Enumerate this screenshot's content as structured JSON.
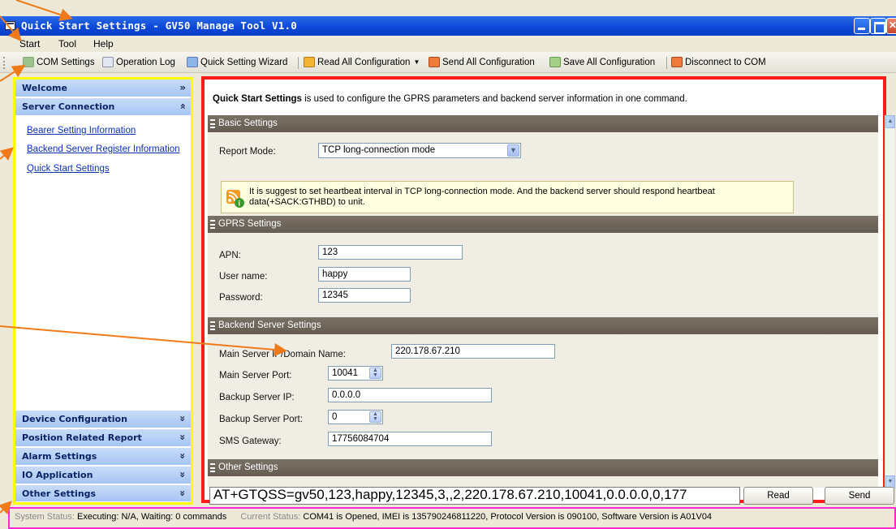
{
  "window": {
    "title": "Quick Start Settings - GV50 Manage Tool V1.0"
  },
  "menu": {
    "items": [
      "Start",
      "Tool",
      "Help"
    ]
  },
  "toolbar": {
    "com_settings": "COM Settings",
    "operation_log": "Operation Log",
    "quick_wizard": "Quick Setting Wizard",
    "read_all": "Read All Configuration",
    "send_all": "Send All Configuration",
    "save_all": "Save All Configuration",
    "disconnect": "Disconnect to COM"
  },
  "sidebar": {
    "welcome": "Welcome",
    "server_connection": "Server Connection",
    "links": [
      "Bearer Setting Information",
      "Backend Server Register Information",
      "Quick Start Settings"
    ],
    "bottom": [
      "Device Configuration",
      "Position Related Report",
      "Alarm Settings",
      "IO Application",
      "Other Settings"
    ]
  },
  "content": {
    "desc_bold": "Quick Start Settings",
    "desc_rest": " is used to configure the GPRS parameters and backend server information in one command.",
    "basic_title": "Basic Settings",
    "report_mode_label": "Report Mode:",
    "report_mode_value": "TCP long-connection mode",
    "tip_text": "It is suggest to set heartbeat interval in TCP long-connection mode. And the backend server should respond heartbeat data(+SACK:GTHBD) to unit.",
    "gprs_title": "GPRS Settings",
    "apn_label": "APN:",
    "apn_value": "123",
    "user_label": "User name:",
    "user_value": "happy",
    "password_label": "Password:",
    "password_value": "12345",
    "backend_title": "Backend Server Settings",
    "main_ip_label": "Main Server IP/Domain Name:",
    "main_ip_value": "220.178.67.210",
    "main_port_label": "Main Server Port:",
    "main_port_value": "10041",
    "backup_ip_label": "Backup Server IP:",
    "backup_ip_value": "0.0.0.0",
    "backup_port_label": "Backup Server Port:",
    "backup_port_value": "0",
    "sms_label": "SMS Gateway:",
    "sms_value": "17756084704",
    "other_title": "Other Settings"
  },
  "command": "AT+GTQSS=gv50,123,happy,12345,3,,2,220.178.67.210,10041,0.0.0.0,0,177",
  "buttons": {
    "read": "Read",
    "send": "Send"
  },
  "status": {
    "system_label": "System Status:",
    "system_value": "Executing: N/A, Waiting: 0 commands",
    "current_label": "Current Status:",
    "current_value": "COM41 is Opened, IMEI is 135790246811220, Protocol Version is 090100, Software Version is A01V04"
  },
  "colors": {
    "sidebar_highlight": "#ffff00",
    "content_highlight": "#ff1b1b",
    "status_highlight": "#ff2ad4",
    "arrow": "#f07a1a"
  }
}
